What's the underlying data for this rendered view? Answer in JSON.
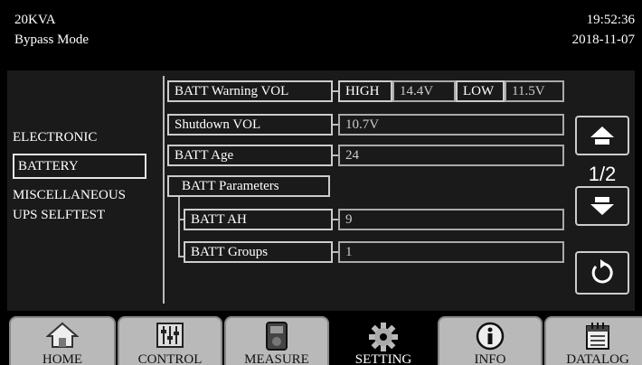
{
  "header": {
    "capacity": "20KVA",
    "mode": "Bypass Mode",
    "time": "19:52:36",
    "date": "2018-11-07"
  },
  "menu": {
    "items": [
      {
        "label": "ELECTRONIC"
      },
      {
        "label": "BATTERY"
      },
      {
        "label": "MISCELLANEOUS"
      },
      {
        "label": "UPS SELFTEST"
      }
    ],
    "selected": "BATTERY"
  },
  "settings": {
    "warning_vol": {
      "label": "BATT Warning VOL",
      "high_label": "HIGH",
      "high_value": "14.4V",
      "low_label": "LOW",
      "low_value": "11.5V"
    },
    "shutdown_vol": {
      "label": "Shutdown VOL",
      "value": "10.7V"
    },
    "batt_age": {
      "label": "BATT Age",
      "value": "24"
    },
    "batt_params": {
      "label": "BATT Parameters"
    },
    "batt_ah": {
      "label": "BATT AH",
      "value": "9"
    },
    "batt_groups": {
      "label": "BATT Groups",
      "value": "1"
    }
  },
  "pager": {
    "indicator": "1/2"
  },
  "icons": {
    "up": "arrow-up-icon",
    "down": "arrow-down-icon",
    "back": "refresh-icon"
  },
  "tabs": [
    {
      "label": "HOME",
      "icon": "home-icon",
      "active": false
    },
    {
      "label": "CONTROL",
      "icon": "sliders-icon",
      "active": false
    },
    {
      "label": "MEASURE",
      "icon": "meter-icon",
      "active": false
    },
    {
      "label": "SETTING",
      "icon": "gear-icon",
      "active": true
    },
    {
      "label": "INFO",
      "icon": "info-icon",
      "active": false
    },
    {
      "label": "DATALOG",
      "icon": "calendar-icon",
      "active": false
    }
  ],
  "colors": {
    "background": "#000000",
    "panel": "#1a1a1a",
    "tab_inactive": "#b9b9b9",
    "text": "#ffffff"
  }
}
